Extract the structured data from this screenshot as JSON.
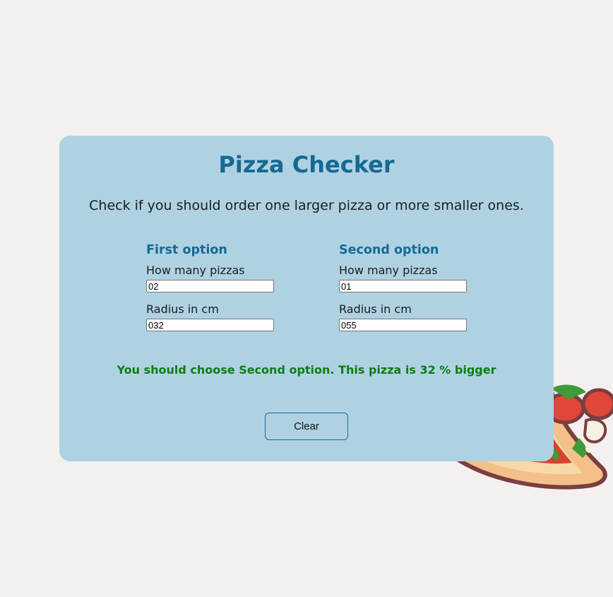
{
  "app": {
    "title": "Pizza Checker",
    "subtitle": "Check if you should order one larger pizza or more smaller ones."
  },
  "options": [
    {
      "heading": "First option",
      "count_label": "How many pizzas",
      "count_value": "02",
      "radius_label": "Radius in cm",
      "radius_value": "032"
    },
    {
      "heading": "Second option",
      "count_label": "How many pizzas",
      "count_value": "01",
      "radius_label": "Radius in cm",
      "radius_value": "055"
    }
  ],
  "result": {
    "text": "You should choose Second option. This pizza is 32 % bigger",
    "color": "#0b7e10"
  },
  "actions": {
    "clear_label": "Clear"
  },
  "colors": {
    "page_background": "#f5f0f0",
    "card_background": "#afd2e3",
    "accent": "#156a93"
  },
  "decoration": {
    "icon": "pizza-slice-icon"
  }
}
